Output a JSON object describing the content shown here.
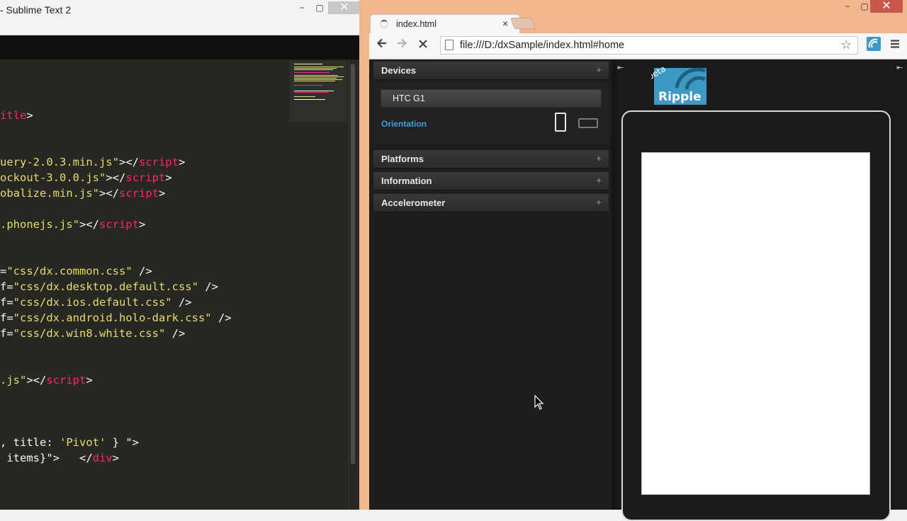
{
  "sublime": {
    "title": "- Sublime Text 2",
    "controls": {
      "minimize": "−",
      "maximize": "▢",
      "close": "✕"
    },
    "code_lines": [
      [
        {
          "c": "t",
          "v": "itle"
        },
        {
          "c": "p",
          "v": ">"
        }
      ],
      [
        {
          "c": "s",
          "v": "uery-2.0.3.min.js\""
        },
        {
          "c": "p",
          "v": "></"
        },
        {
          "c": "t",
          "v": "script"
        },
        {
          "c": "p",
          "v": ">"
        }
      ],
      [
        {
          "c": "s",
          "v": "ockout-3.0.0.js\""
        },
        {
          "c": "p",
          "v": "></"
        },
        {
          "c": "t",
          "v": "script"
        },
        {
          "c": "p",
          "v": ">"
        }
      ],
      [
        {
          "c": "s",
          "v": "obalize.min.js\""
        },
        {
          "c": "p",
          "v": "></"
        },
        {
          "c": "t",
          "v": "script"
        },
        {
          "c": "p",
          "v": ">"
        }
      ],
      [
        {
          "c": "s",
          "v": ".phonejs.js\""
        },
        {
          "c": "p",
          "v": "></"
        },
        {
          "c": "t",
          "v": "script"
        },
        {
          "c": "p",
          "v": ">"
        }
      ],
      [
        {
          "c": "p",
          "v": "="
        },
        {
          "c": "s",
          "v": "\"css/dx.common.css\""
        },
        {
          "c": "p",
          "v": " />"
        }
      ],
      [
        {
          "c": "p",
          "v": "f="
        },
        {
          "c": "s",
          "v": "\"css/dx.desktop.default.css\""
        },
        {
          "c": "p",
          "v": " />"
        }
      ],
      [
        {
          "c": "p",
          "v": "f="
        },
        {
          "c": "s",
          "v": "\"css/dx.ios.default.css\""
        },
        {
          "c": "p",
          "v": " />"
        }
      ],
      [
        {
          "c": "p",
          "v": "f="
        },
        {
          "c": "s",
          "v": "\"css/dx.android.holo-dark.css\""
        },
        {
          "c": "p",
          "v": " />"
        }
      ],
      [
        {
          "c": "p",
          "v": "f="
        },
        {
          "c": "s",
          "v": "\"css/dx.win8.white.css\""
        },
        {
          "c": "p",
          "v": " />"
        }
      ],
      [
        {
          "c": "s",
          "v": ".js\""
        },
        {
          "c": "p",
          "v": "></"
        },
        {
          "c": "t",
          "v": "script"
        },
        {
          "c": "p",
          "v": ">"
        }
      ],
      [
        {
          "c": "p",
          "v": ", title: "
        },
        {
          "c": "s",
          "v": "'Pivot'"
        },
        {
          "c": "p",
          "v": " } \">"
        }
      ],
      [
        {
          "c": "p",
          "v": " items}\">   </"
        },
        {
          "c": "t",
          "v": "div"
        },
        {
          "c": "p",
          "v": ">"
        }
      ]
    ]
  },
  "chrome": {
    "tab_title": "index.html",
    "tab_close": "×",
    "url": "file:///D:/dxSample/index.html#home",
    "controls": {
      "minimize": "−",
      "maximize": "▢",
      "close": "✕"
    }
  },
  "ripple": {
    "panels": [
      {
        "label": "Devices",
        "expanded": true
      },
      {
        "label": "Platforms",
        "expanded": false
      },
      {
        "label": "Information",
        "expanded": false
      },
      {
        "label": "Accelerometer",
        "expanded": false
      }
    ],
    "device": "HTC G1",
    "orientation_label": "Orientation",
    "plus_glyph": "+",
    "logo_text": "Ripple",
    "logo_badge": "beta",
    "colors": {
      "accent": "#3aa3df",
      "logo": "#3d98c4"
    }
  }
}
